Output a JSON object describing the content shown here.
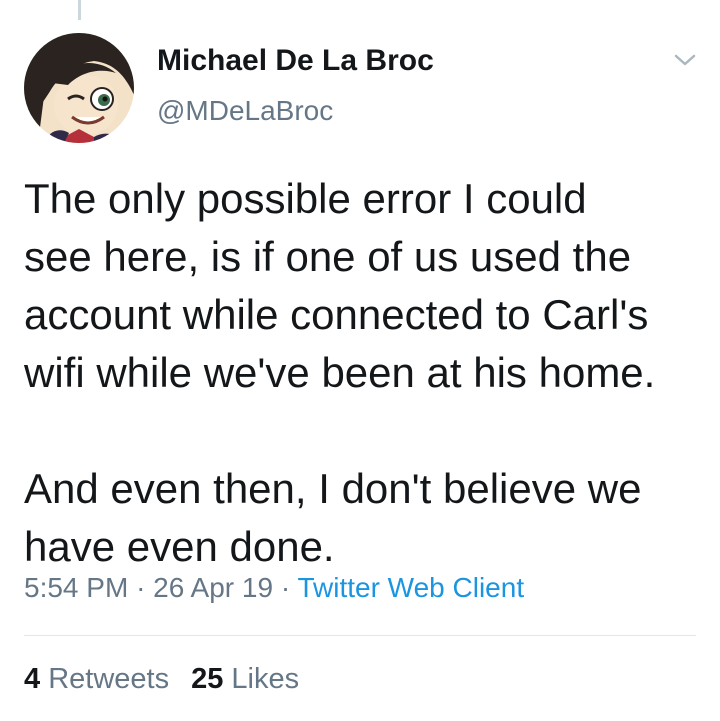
{
  "author": {
    "name": "Michael De La Broc",
    "handle": "@MDeLaBroc",
    "avatar_icon": "anime-avatar-icon"
  },
  "tweet": {
    "lines": [
      "The only possible error I could",
      "see here, is if one of us used the",
      "account while connected to Carl's",
      "wifi while we've been at his home."
    ],
    "lines2": [
      "And even then, I don't believe we",
      "have even done."
    ]
  },
  "meta": {
    "time": "5:54 PM",
    "separator": "·",
    "date": "26 Apr 19",
    "source": "Twitter Web Client"
  },
  "stats": {
    "retweets_count": "4",
    "retweets_label": "Retweets",
    "likes_count": "25",
    "likes_label": "Likes"
  },
  "colors": {
    "text": "#14171a",
    "secondary": "#657786",
    "link": "#1b95e0",
    "divider": "#e1e8ed"
  }
}
